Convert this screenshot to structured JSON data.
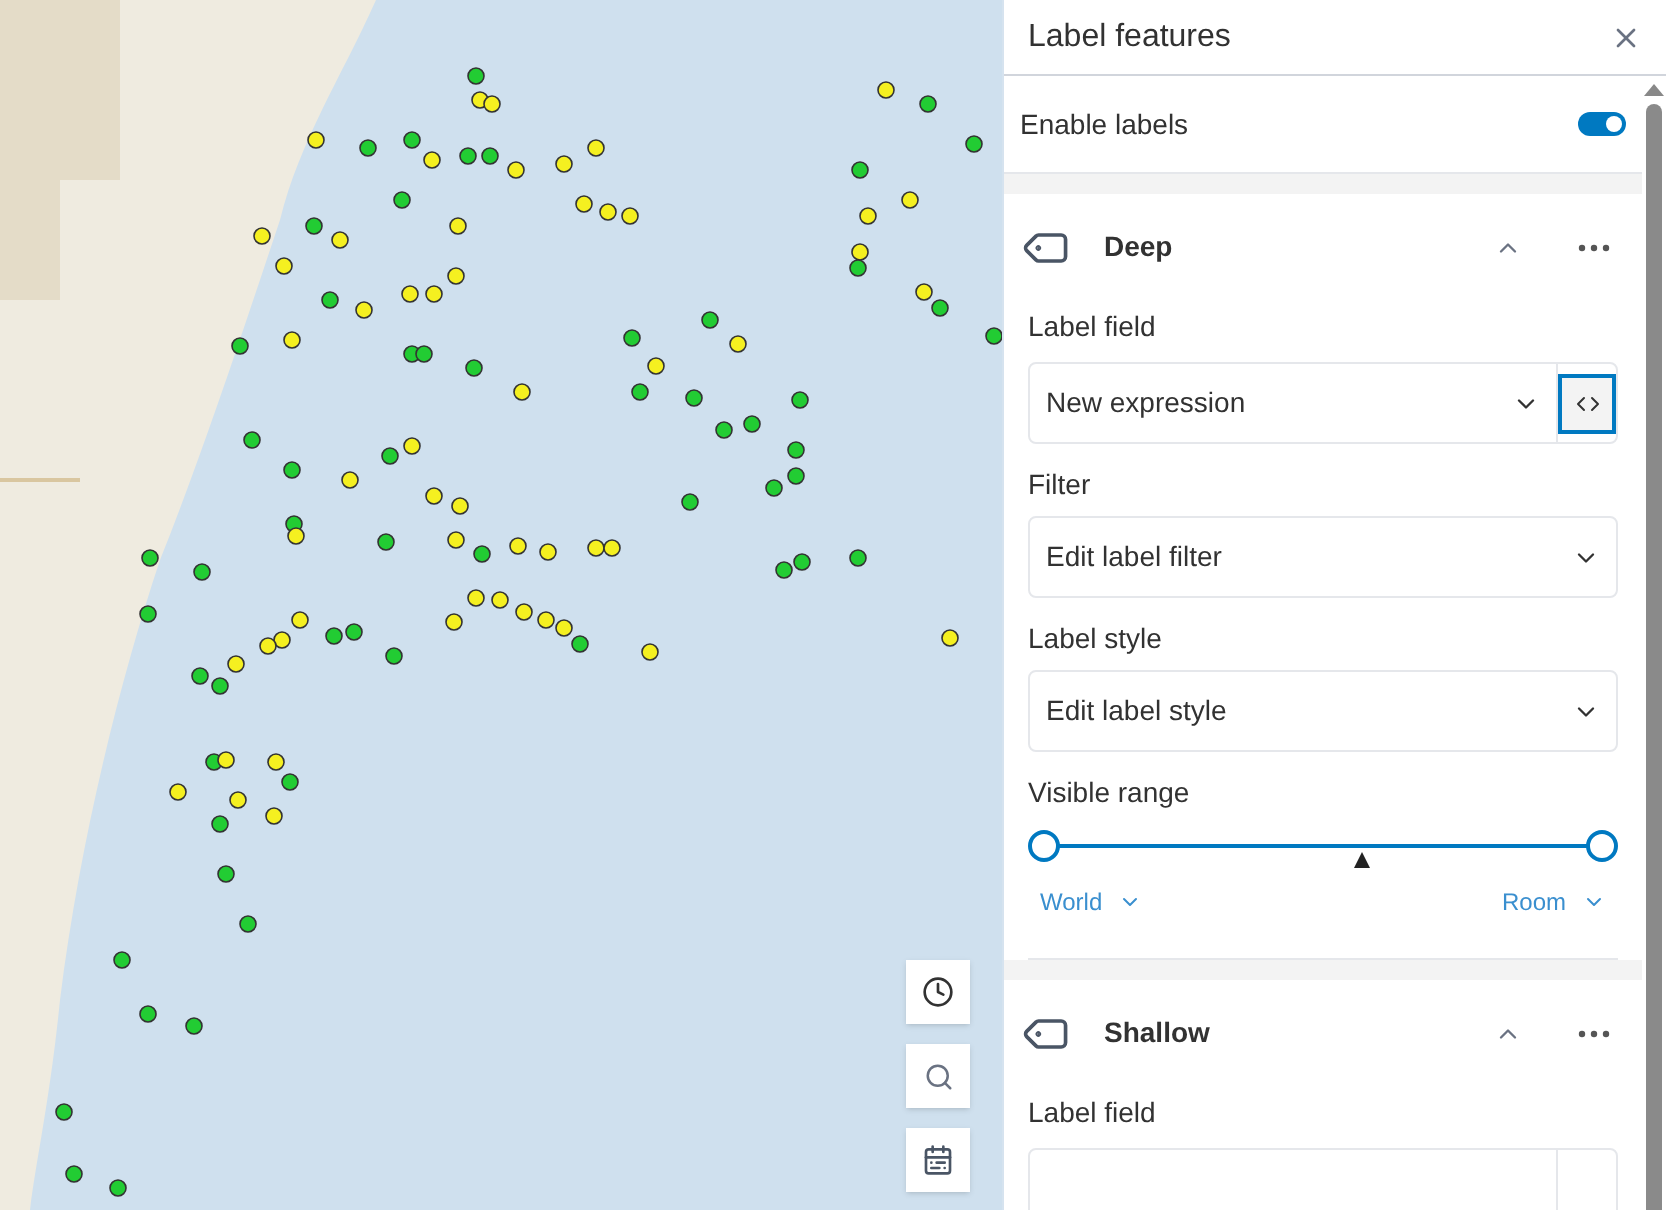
{
  "panel": {
    "title": "Label features",
    "enable_labels": {
      "label": "Enable labels",
      "on": true
    },
    "classes": [
      {
        "name": "Deep",
        "expanded": true,
        "label_field": {
          "label": "Label field",
          "value": "New expression"
        },
        "filter": {
          "label": "Filter",
          "value": "Edit label filter"
        },
        "style": {
          "label": "Label style",
          "value": "Edit label style"
        },
        "visible_range": {
          "label": "Visible range",
          "min_thumb": {
            "level": 0
          },
          "max_thumb": {
            "level": 1
          },
          "current_scale": {
            "level": 0.57
          },
          "min_label": "World",
          "max_label": "Room"
        }
      },
      {
        "name": "Shallow",
        "expanded": true,
        "label_field": {
          "label": "Label field"
        }
      }
    ]
  }
}
